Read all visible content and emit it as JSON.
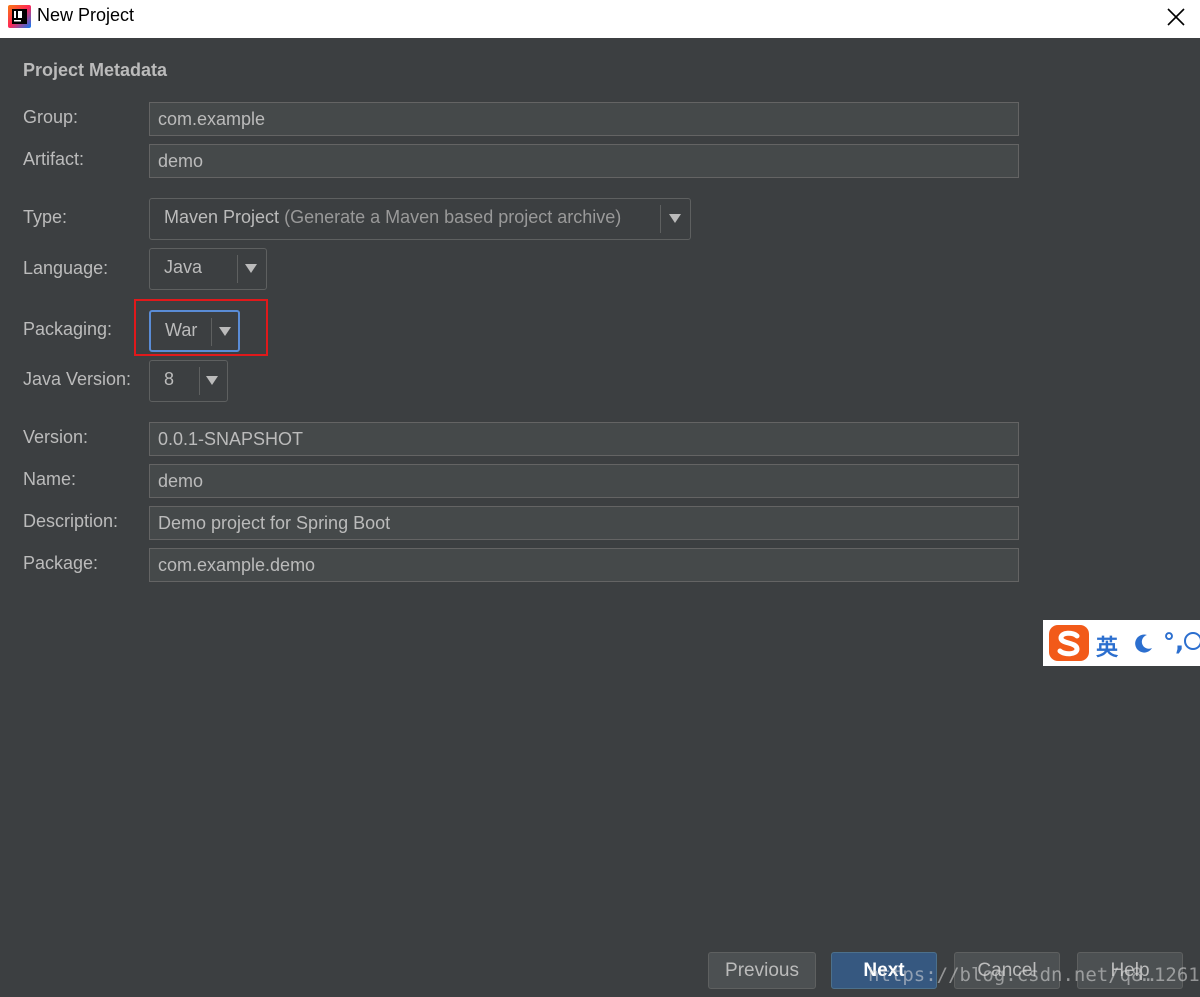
{
  "window": {
    "title": "New Project",
    "close_icon": "close-icon",
    "app_icon": "intellij-icon"
  },
  "section_title": "Project Metadata",
  "fields": {
    "group": {
      "label": "Group:",
      "value": "com.example"
    },
    "artifact": {
      "label": "Artifact:",
      "value": "demo"
    },
    "type": {
      "label": "Type:",
      "value": "Maven Project",
      "hint": "(Generate a Maven based project archive)"
    },
    "language": {
      "label": "Language:",
      "value": "Java"
    },
    "packaging": {
      "label": "Packaging:",
      "value": "War"
    },
    "java_version": {
      "label": "Java Version:",
      "value": "8"
    },
    "version": {
      "label": "Version:",
      "value": "0.0.1-SNAPSHOT"
    },
    "name": {
      "label": "Name:",
      "value": "demo"
    },
    "description": {
      "label": "Description:",
      "value": "Demo project for Spring Boot"
    },
    "package": {
      "label": "Package:",
      "value": "com.example.demo"
    }
  },
  "ime": {
    "mode": "英",
    "punct": "°,"
  },
  "buttons": {
    "previous": "Previous",
    "next": "Next",
    "cancel": "Cancel",
    "help": "Help"
  },
  "watermark": "https://blog.csdn.net/q8…1261",
  "colors": {
    "background": "#3c3f41",
    "highlight": "#e0191b",
    "focus": "#5a8cd6",
    "default_button": "#365880"
  }
}
